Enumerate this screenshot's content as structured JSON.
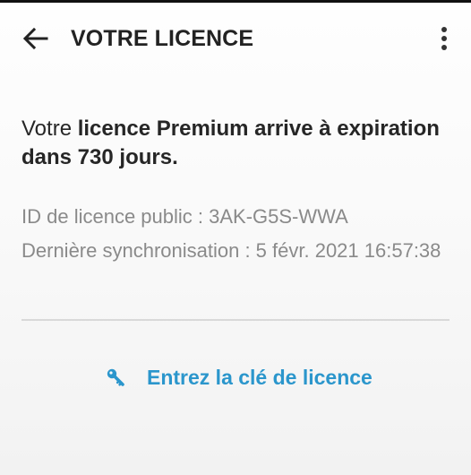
{
  "header": {
    "title": "VOTRE LICENCE"
  },
  "status": {
    "prefix": "Votre ",
    "bold_text": "licence Premium arrive à expiration dans 730 jours."
  },
  "license": {
    "public_id_label": "ID de licence public : 3AK-G5S-WWA",
    "last_sync_label": "Dernière synchronisation : 5 févr. 2021 16:57:38"
  },
  "actions": {
    "enter_key_label": "Entrez la clé de licence"
  },
  "colors": {
    "accent": "#2b96cc",
    "title_text": "#222222",
    "secondary_text": "#8a8a8a"
  }
}
